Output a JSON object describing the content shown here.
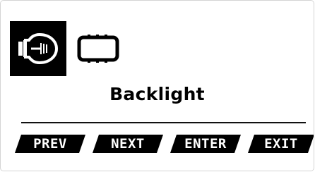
{
  "menu": {
    "title": "Backlight",
    "icons": [
      {
        "name": "lightbulb-icon",
        "selected": true
      },
      {
        "name": "display-panel-icon",
        "selected": false
      }
    ]
  },
  "softkeys": {
    "prev": "PREV",
    "next": "NEXT",
    "enter": "ENTER",
    "exit": "EXIT"
  },
  "colors": {
    "background": "#ffffff",
    "foreground": "#000000",
    "inverse_text": "#ffffff"
  }
}
